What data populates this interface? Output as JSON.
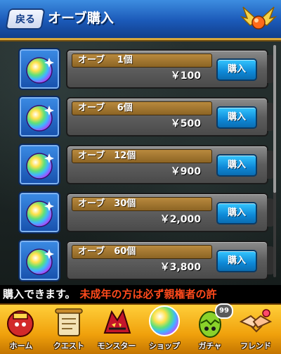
{
  "header": {
    "back_label": "戻る",
    "title": "オーブ購入"
  },
  "products": [
    {
      "name": "オーブ　 1個",
      "price": "￥100",
      "buy_label": "購入"
    },
    {
      "name": "オーブ　 6個",
      "price": "￥500",
      "buy_label": "購入"
    },
    {
      "name": "オーブ　12個",
      "price": "￥900",
      "buy_label": "購入"
    },
    {
      "name": "オーブ　30個",
      "price": "￥2,000",
      "buy_label": "購入"
    },
    {
      "name": "オーブ　60個",
      "price": "￥3,800",
      "buy_label": "購入"
    }
  ],
  "message": {
    "primary": "購入できます。",
    "warning": "未成年の方は必ず親権者の許"
  },
  "nav": {
    "items": [
      {
        "label": "ホーム",
        "icon": "home-icon"
      },
      {
        "label": "クエスト",
        "icon": "quest-scroll-icon"
      },
      {
        "label": "モンスター",
        "icon": "monster-icon"
      },
      {
        "label": "ショップ",
        "icon": "shop-orb-icon"
      },
      {
        "label": "ガチャ",
        "icon": "gacha-egg-icon",
        "badge": "99"
      },
      {
        "label": "フレンド",
        "icon": "friend-handshake-icon"
      }
    ]
  },
  "colors": {
    "header_blue": "#1b59b8",
    "buy_button": "#0e88d6",
    "nav_gold": "#f0a10c",
    "warning_red": "#ff4a1c"
  }
}
